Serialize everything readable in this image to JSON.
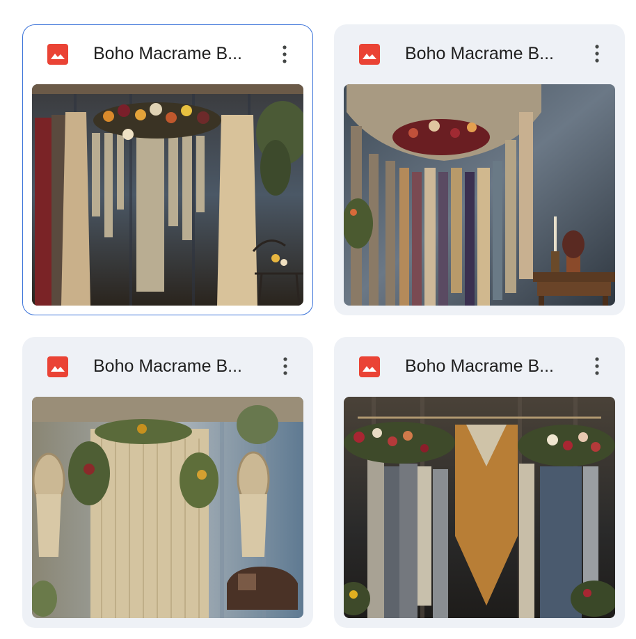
{
  "files": [
    {
      "title": "Boho Macrame B...",
      "selected": true,
      "icon": "image-file-icon",
      "thumbnail": "macrame-backdrop-dark-wood-flowers"
    },
    {
      "title": "Boho Macrame B...",
      "selected": false,
      "icon": "image-file-icon",
      "thumbnail": "macrame-backdrop-blue-wall-table"
    },
    {
      "title": "Boho Macrame B...",
      "selected": false,
      "icon": "image-file-icon",
      "thumbnail": "macrame-backdrop-light-blue-wall-chair"
    },
    {
      "title": "Boho Macrame B...",
      "selected": false,
      "icon": "image-file-icon",
      "thumbnail": "macrame-backdrop-dark-roses"
    }
  ],
  "colors": {
    "card_bg": "#eef1f6",
    "selected_border": "#3b73d9",
    "icon_red": "#ea4335",
    "title_text": "#1f1f1f",
    "more_icon": "#444746"
  }
}
